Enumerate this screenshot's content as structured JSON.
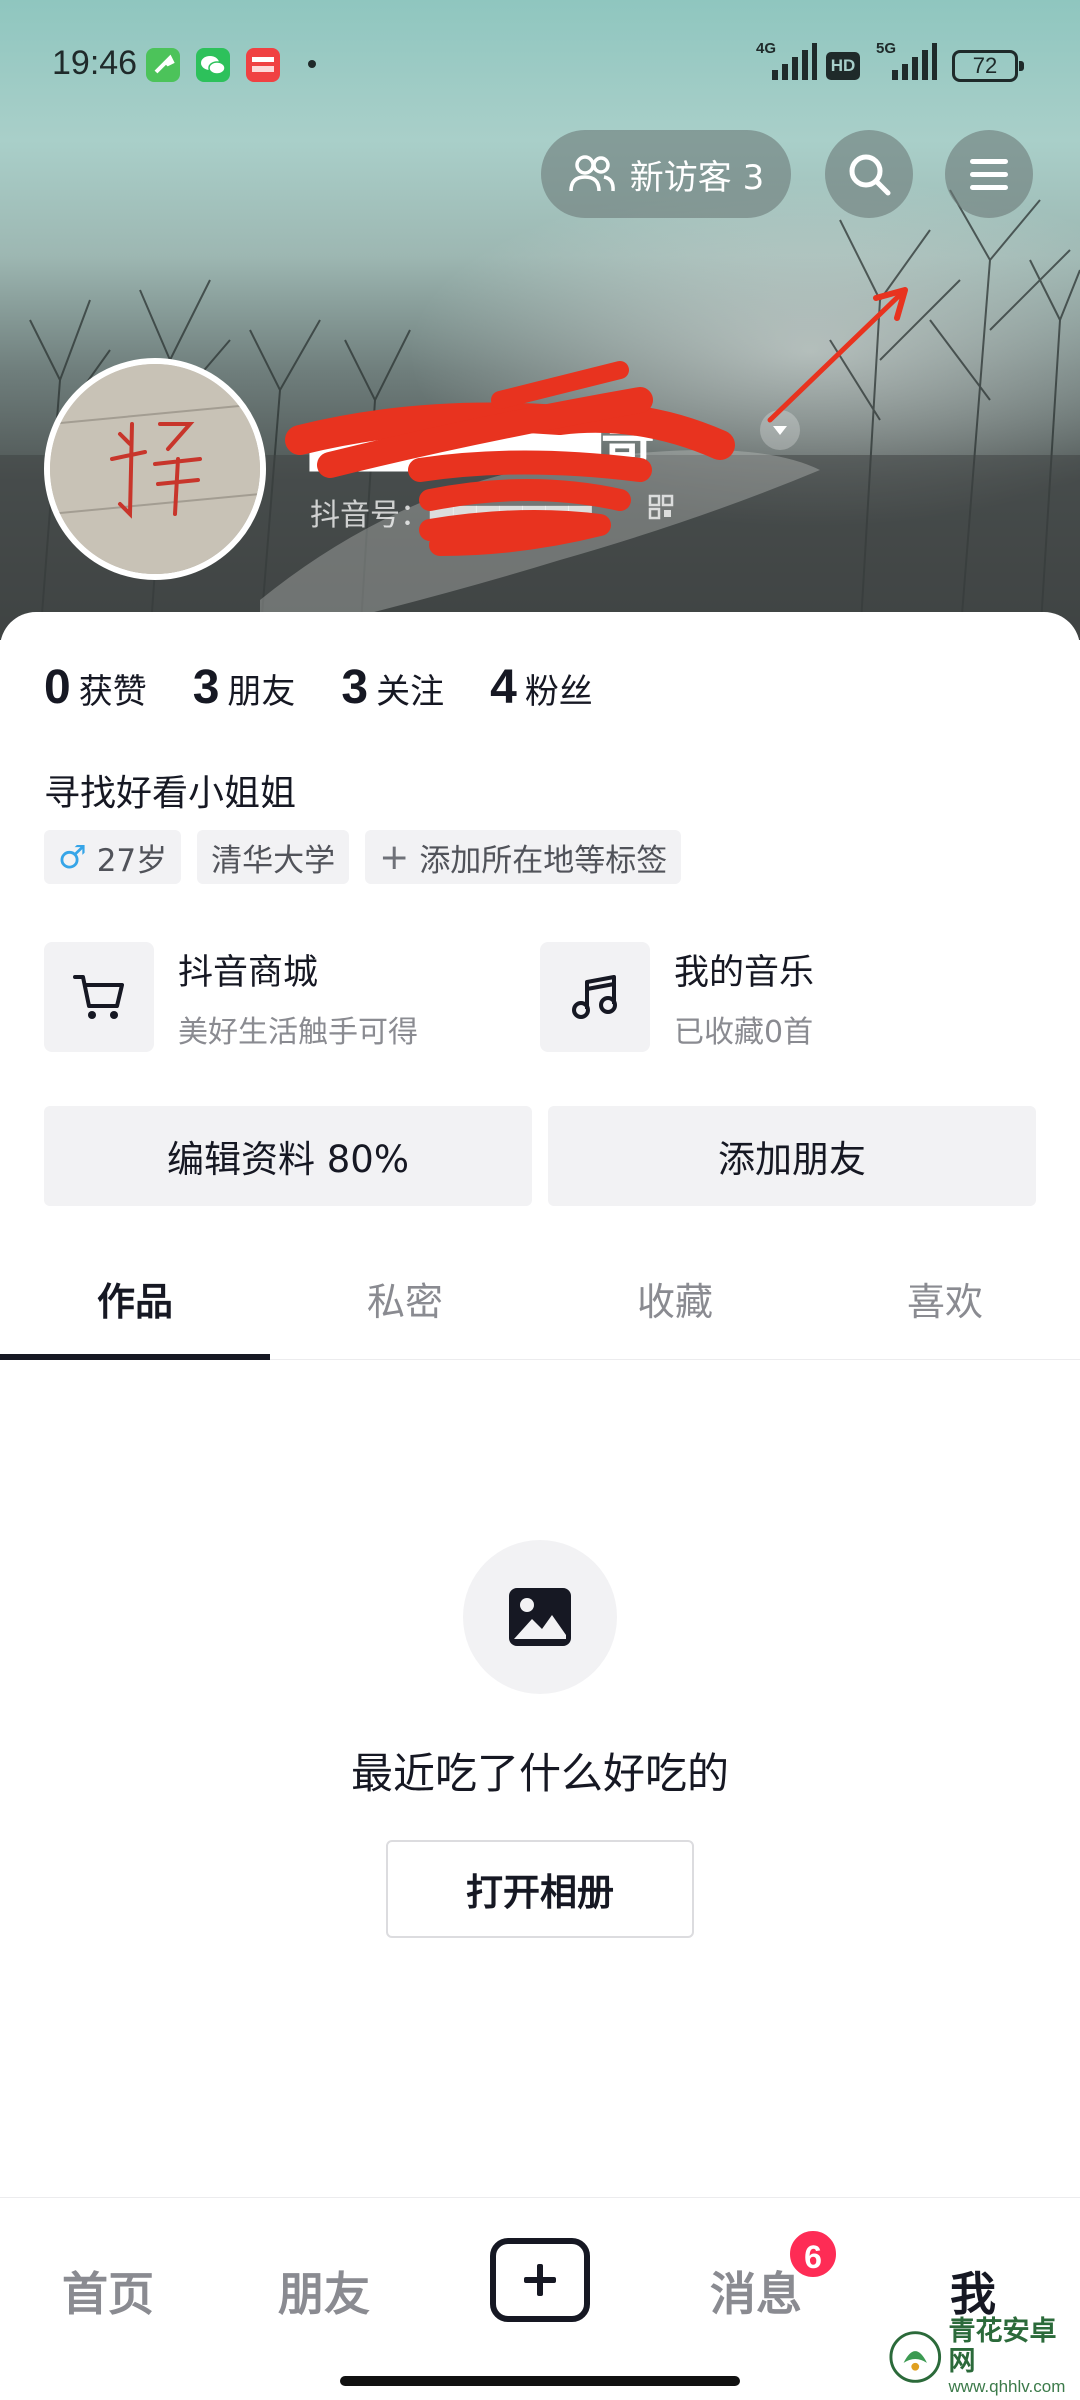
{
  "status_bar": {
    "time": "19:46",
    "net1": "4G",
    "net2": "5G",
    "hd": "HD",
    "battery": "72",
    "apps": [
      "wrench-app-icon",
      "wechat-app-icon",
      "toutiao-app-icon"
    ]
  },
  "header": {
    "visitors_label": "新访客 3",
    "profile_name": "▆▆▆▆▆▆▆哥",
    "douyin_id": "抖音号：▆▆▆▆▆▆▆"
  },
  "stats": [
    {
      "num": "0",
      "label": "获赞"
    },
    {
      "num": "3",
      "label": "朋友"
    },
    {
      "num": "3",
      "label": "关注"
    },
    {
      "num": "4",
      "label": "粉丝"
    }
  ],
  "bio": "寻找好看小姐姐",
  "tags": {
    "gender_symbol": "♂",
    "age": "27岁",
    "school": "清华大学",
    "add_label": "添加所在地等标签"
  },
  "features": {
    "shop": {
      "title": "抖音商城",
      "subtitle": "美好生活触手可得"
    },
    "music": {
      "title": "我的音乐",
      "subtitle": "已收藏0首"
    }
  },
  "actions": {
    "edit": "编辑资料 80%",
    "add_friend": "添加朋友"
  },
  "tabs": [
    "作品",
    "私密",
    "收藏",
    "喜欢"
  ],
  "empty_state": {
    "text": "最近吃了什么好吃的",
    "button": "打开相册"
  },
  "bottom_nav": {
    "home": "首页",
    "friends": "朋友",
    "messages": "消息",
    "me": "我",
    "messages_badge": "6"
  },
  "watermark": {
    "name": "青花安卓网",
    "url": "www.qhhlv.com"
  },
  "colors": {
    "accent_red": "#fe2c55",
    "annotation_red": "#e8331f",
    "text_primary": "#161823",
    "text_secondary": "#8a8b91",
    "chip_bg": "#f2f2f4"
  }
}
